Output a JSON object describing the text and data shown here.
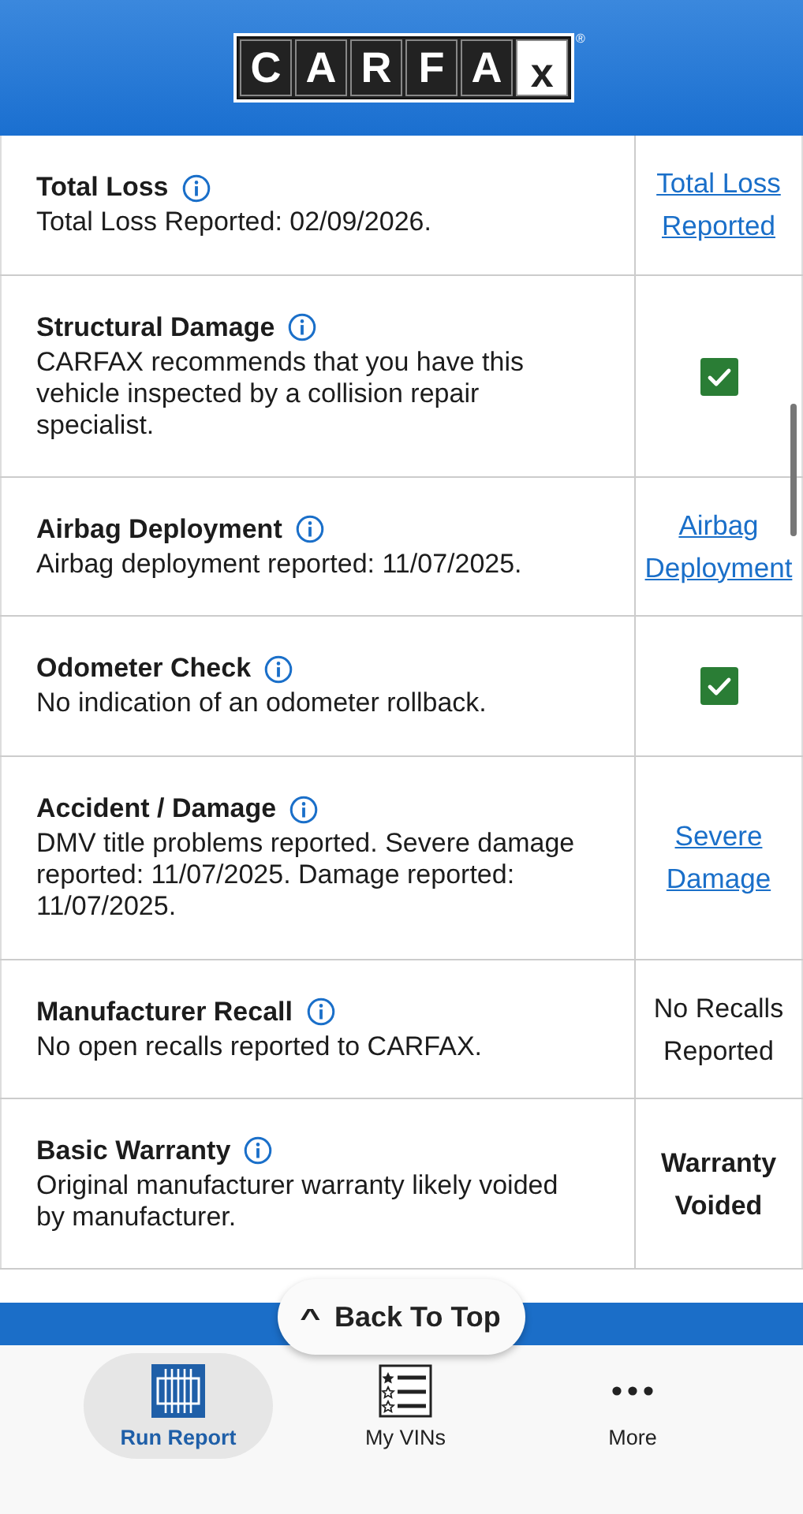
{
  "header": {
    "logo_letters": [
      "C",
      "A",
      "R",
      "F",
      "A",
      "x"
    ],
    "registered_mark": "®"
  },
  "records": [
    {
      "title": "Total Loss",
      "description": "Total Loss Reported: 02/09/2026.",
      "result": {
        "kind": "link",
        "text": "Total Loss Reported"
      }
    },
    {
      "title": "Structural Damage",
      "description": "CARFAX recommends that you have this vehicle inspected by a collision repair specialist.",
      "result": {
        "kind": "check"
      }
    },
    {
      "title": "Airbag Deployment",
      "description": "Airbag deployment reported: 11/07/2025.",
      "result": {
        "kind": "link",
        "text": "Airbag Deployment"
      }
    },
    {
      "title": "Odometer Check",
      "description": "No indication of an odometer rollback.",
      "result": {
        "kind": "check"
      }
    },
    {
      "title": "Accident / Damage",
      "description": "DMV title problems reported. Severe damage reported: 11/07/2025. Damage reported: 11/07/2025.",
      "result": {
        "kind": "link",
        "text": "Severe Damage"
      }
    },
    {
      "title": "Manufacturer Recall",
      "description": "No open recalls reported to CARFAX.",
      "result": {
        "kind": "text",
        "text": "No Recalls Reported"
      }
    },
    {
      "title": "Basic Warranty",
      "description": "Original manufacturer warranty likely voided by manufacturer.",
      "result": {
        "kind": "bold",
        "text": "Warranty Voided"
      }
    }
  ],
  "back_to_top": {
    "arrow": "^",
    "label": "Back To Top"
  },
  "nav": [
    {
      "label": "Run Report",
      "kind": "report",
      "selected": true
    },
    {
      "label": "My VINs",
      "kind": "list",
      "selected": false
    },
    {
      "label": "More",
      "kind": "more",
      "selected": false
    }
  ]
}
